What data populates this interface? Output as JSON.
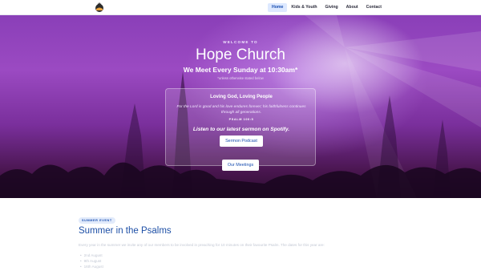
{
  "nav": {
    "items": [
      {
        "label": "Home",
        "active": true
      },
      {
        "label": "Kids & Youth",
        "active": false
      },
      {
        "label": "Giving",
        "active": false
      },
      {
        "label": "About",
        "active": false
      },
      {
        "label": "Contact",
        "active": false
      }
    ]
  },
  "hero": {
    "welcome": "WELCOME TO",
    "title": "Hope Church",
    "subtitle": "We Meet Every Sunday at 10:30am*",
    "note": "*unless otherwise stated below",
    "card": {
      "title": "Loving God, Loving People",
      "verse": "For the Lord is good and his love endures forever; his faithfulness continues through all generations.",
      "reference": "PSALM 100:5",
      "spotify_text": "Listen to our latest sermon on Spotify.",
      "podcast_button": "Sermon Podcast"
    },
    "meetings_button": "Our Meetings"
  },
  "section": {
    "badge": "SUMMER EVENT",
    "title": "Summer in the Psalms",
    "text": "Every year in the summer we invite any of our members to be involved in preaching for 10 minutes on their favourite Psalm. The dates for this year are:",
    "dates": [
      "2nd August",
      "9th August",
      "16th August"
    ]
  },
  "colors": {
    "accent": "#1a4fb0",
    "nav_active_bg": "#dde9ff",
    "hero_purple": "#8a3fb8",
    "muted_text": "#c3c8d4"
  },
  "icons": {
    "logo": "church-logo-icon"
  }
}
